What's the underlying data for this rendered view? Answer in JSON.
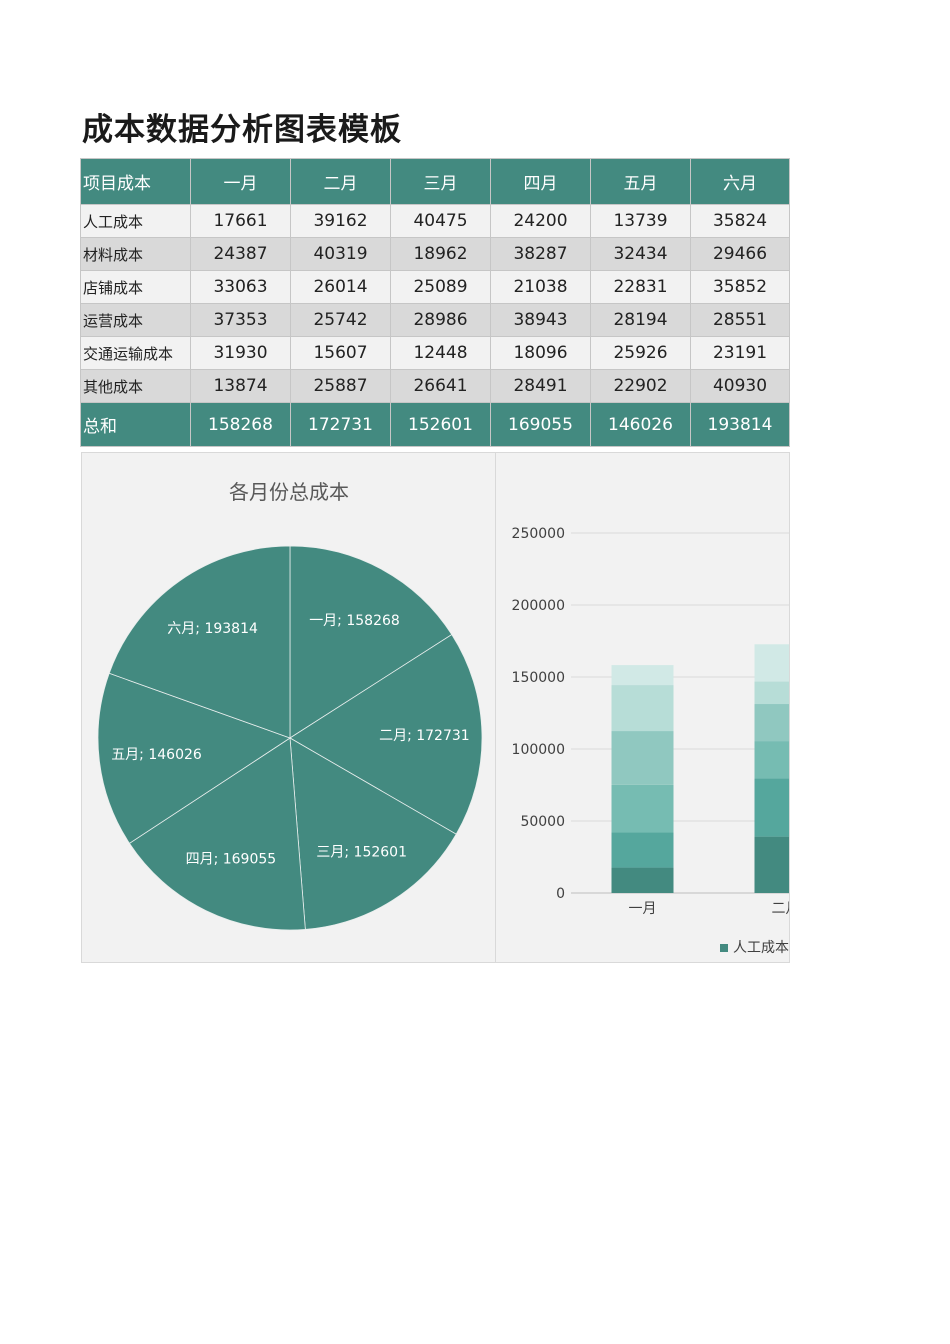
{
  "title": "成本数据分析图表模板",
  "colors": {
    "header": "#438a80",
    "row_odd": "#f2f2f2",
    "row_even": "#d9d9d9"
  },
  "table": {
    "headers": [
      "项目成本",
      "一月",
      "二月",
      "三月",
      "四月",
      "五月",
      "六月"
    ],
    "rows": [
      {
        "label": "人工成本",
        "values": [
          "17661",
          "39162",
          "40475",
          "24200",
          "13739",
          "35824"
        ]
      },
      {
        "label": "材料成本",
        "values": [
          "24387",
          "40319",
          "18962",
          "38287",
          "32434",
          "29466"
        ]
      },
      {
        "label": "店铺成本",
        "values": [
          "33063",
          "26014",
          "25089",
          "21038",
          "22831",
          "35852"
        ]
      },
      {
        "label": "运营成本",
        "values": [
          "37353",
          "25742",
          "28986",
          "38943",
          "28194",
          "28551"
        ]
      },
      {
        "label": "交通运输成本",
        "values": [
          "31930",
          "15607",
          "12448",
          "18096",
          "25926",
          "23191"
        ]
      },
      {
        "label": "其他成本",
        "values": [
          "13874",
          "25887",
          "26641",
          "28491",
          "22902",
          "40930"
        ]
      }
    ],
    "total": {
      "label": "总和",
      "values": [
        "158268",
        "172731",
        "152601",
        "169055",
        "146026",
        "193814"
      ]
    }
  },
  "chart_data": [
    {
      "type": "pie",
      "title": "各月份总成本",
      "labels": [
        "一月",
        "二月",
        "三月",
        "四月",
        "五月",
        "六月"
      ],
      "values": [
        158268,
        172731,
        152601,
        169055,
        146026,
        193814
      ],
      "data_labels": [
        "一月; 158268",
        "二月; 172731",
        "三月; 152601",
        "四月; 169055",
        "五月; 146026",
        "六月; 193814"
      ],
      "color": "#438a80"
    },
    {
      "type": "bar",
      "stacked": true,
      "categories": [
        "一月",
        "二月"
      ],
      "visible_category_labels": [
        "一月",
        "二月"
      ],
      "series": [
        {
          "name": "人工成本",
          "values": [
            17661,
            39162
          ],
          "color": "#438a80"
        },
        {
          "values": [
            24387,
            40319
          ],
          "color": "#55a79d"
        },
        {
          "values": [
            33063,
            26014
          ],
          "color": "#76bcb2"
        },
        {
          "values": [
            37353,
            25742
          ],
          "color": "#90c8c0"
        },
        {
          "values": [
            31930,
            15607
          ],
          "color": "#b7ddd7"
        },
        {
          "values": [
            13874,
            25887
          ],
          "color": "#d1e9e6"
        }
      ],
      "legend_label": "人工成本",
      "yticks": [
        "0",
        "50000",
        "100000",
        "150000",
        "200000",
        "250000"
      ],
      "ylim": [
        0,
        250000
      ],
      "grid": true,
      "legend": "bottom"
    }
  ]
}
